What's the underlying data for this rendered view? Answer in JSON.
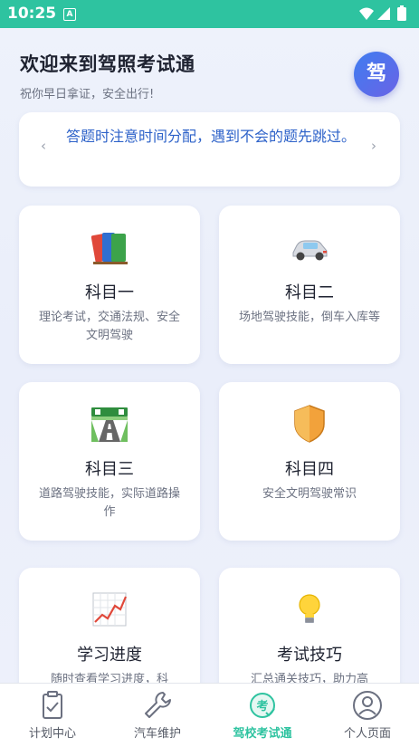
{
  "status_bar": {
    "time": "10:25",
    "notification_icon": "A"
  },
  "header": {
    "title": "欢迎来到驾照考试通",
    "subtitle": "祝你早日拿证，安全出行!",
    "avatar_text": "驾"
  },
  "tip": {
    "text": "答题时注意时间分配，遇到不会的题先跳过。",
    "prev": "‹",
    "next": "›"
  },
  "cards": [
    {
      "title": "科目一",
      "desc": "理论考试，交通法规、安全文明驾驶",
      "icon": "books-icon"
    },
    {
      "title": "科目二",
      "desc": "场地驾驶技能，倒车入库等",
      "icon": "car-icon"
    },
    {
      "title": "科目三",
      "desc": "道路驾驶技能，实际道路操作",
      "icon": "road-icon"
    },
    {
      "title": "科目四",
      "desc": "安全文明驾驶常识",
      "icon": "shield-icon"
    },
    {
      "title": "学习进度",
      "desc": "随时查看学习进度，科",
      "icon": "chart-icon"
    },
    {
      "title": "考试技巧",
      "desc": "汇总通关技巧，助力高",
      "icon": "lightbulb-icon"
    }
  ],
  "tabs": [
    {
      "label": "计划中心",
      "icon": "clipboard-check-icon"
    },
    {
      "label": "汽车维护",
      "icon": "wrench-icon"
    },
    {
      "label": "驾校考试通",
      "icon": "exam-icon",
      "active": true
    },
    {
      "label": "个人页面",
      "icon": "user-icon"
    }
  ],
  "colors": {
    "accent": "#2ec3a0",
    "tip_text": "#2d62c9",
    "avatar_start": "#3f7df0",
    "avatar_end": "#6a63e6"
  }
}
